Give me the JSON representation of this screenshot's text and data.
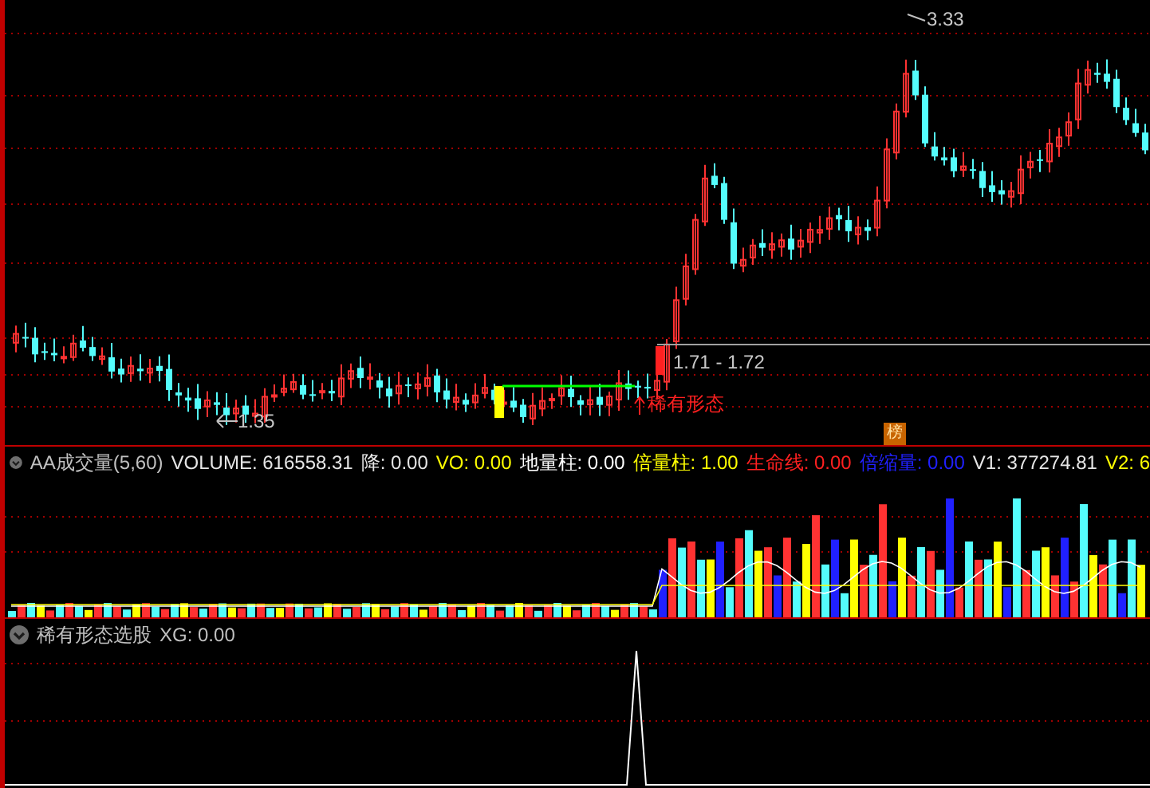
{
  "price_panel": {
    "high_label": "3.33",
    "low_label": "1.35",
    "range_label": "1.71 - 1.72",
    "signal_label": "稀有形态",
    "badge": "榜"
  },
  "volume_panel": {
    "items": [
      {
        "text": "AA成交量(5,60)",
        "color": "#c0c0c0"
      },
      {
        "text": "VOLUME: 616558.31",
        "color": "#e6e6e6"
      },
      {
        "text": "降: 0.00",
        "color": "#e6e6e6"
      },
      {
        "text": "VO: 0.00",
        "color": "#ffff00"
      },
      {
        "text": "地量柱: 0.00",
        "color": "#ffffff"
      },
      {
        "text": "倍量柱: 1.00",
        "color": "#ffff00"
      },
      {
        "text": "生命线: 0.00",
        "color": "#ff2020"
      },
      {
        "text": "倍缩量: 0.00",
        "color": "#2020ff"
      },
      {
        "text": "V1: 377274.81",
        "color": "#e6e6e6"
      },
      {
        "text": "V2: 6",
        "color": "#ffff00"
      }
    ]
  },
  "signal_panel": {
    "items": [
      {
        "text": "稀有形态选股",
        "color": "#c0c0c0"
      },
      {
        "text": "XG: 0.00",
        "color": "#c0c0c0"
      }
    ]
  }
}
